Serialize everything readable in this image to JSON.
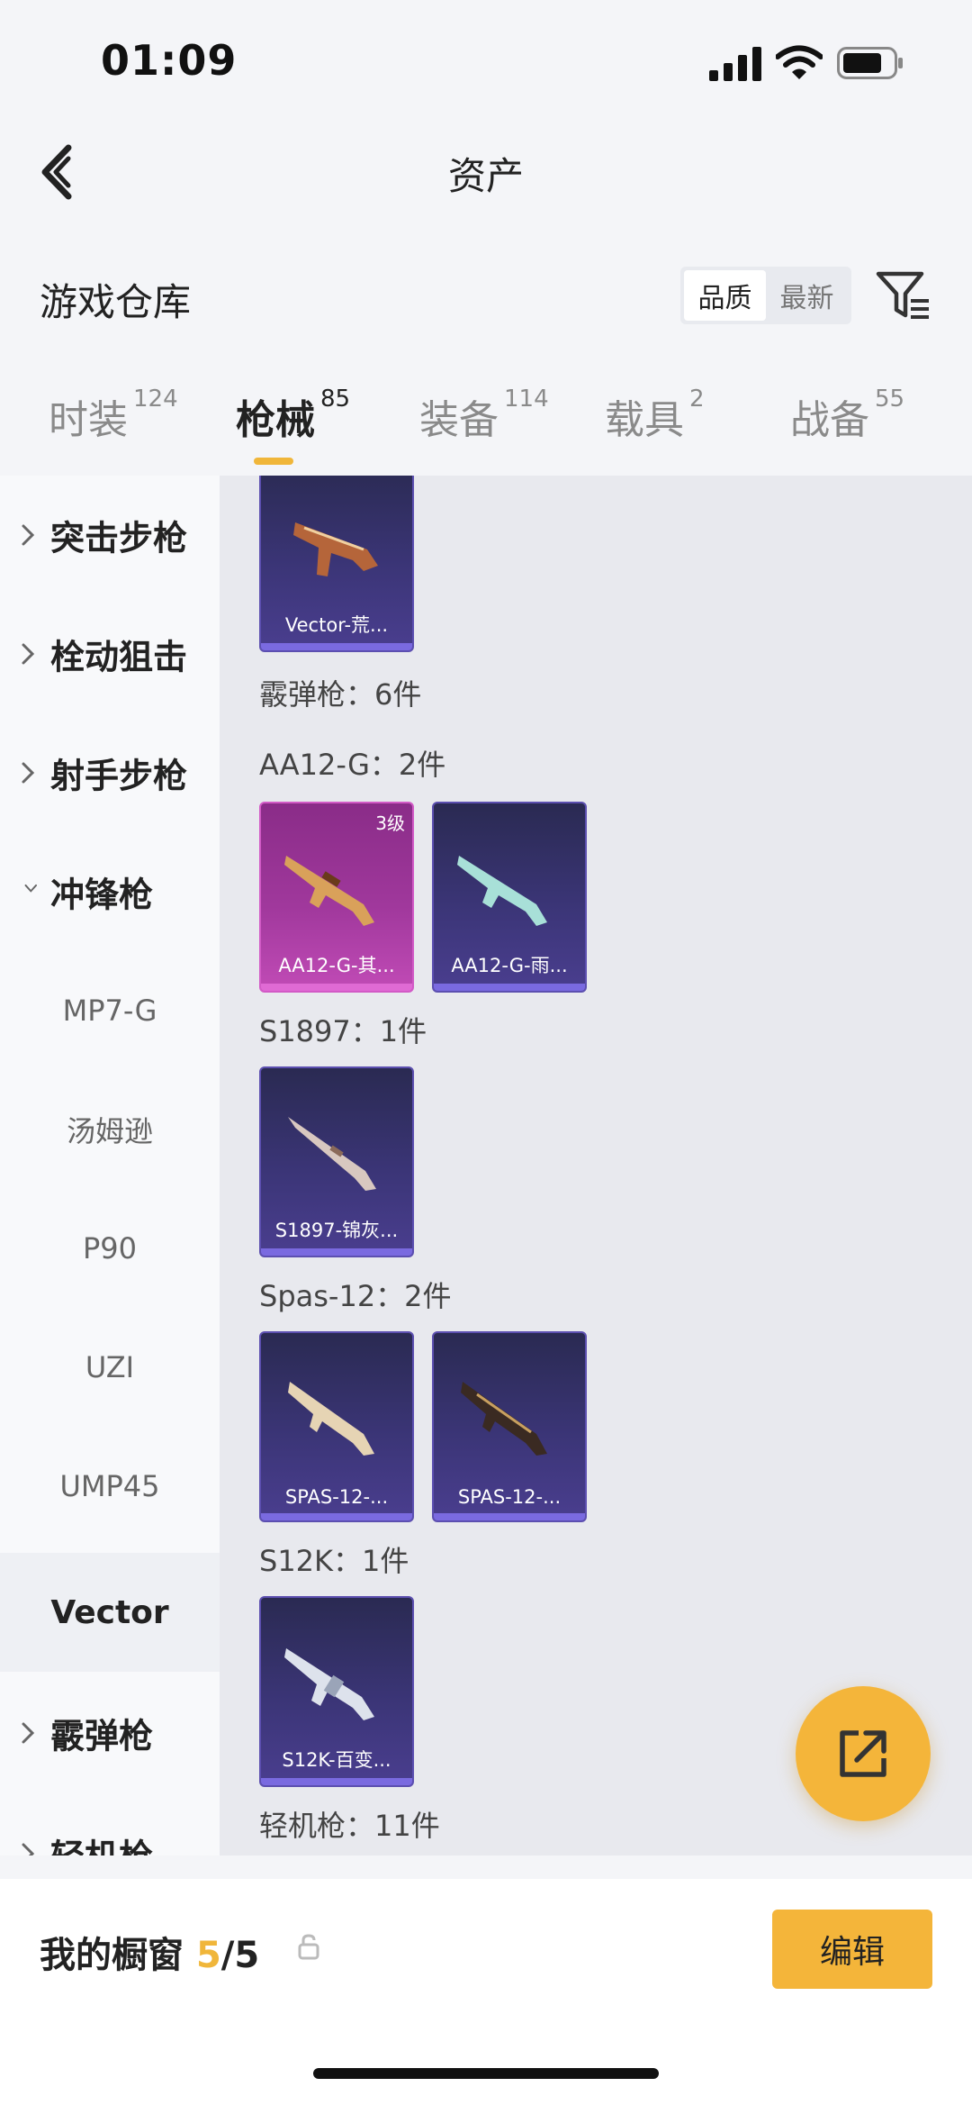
{
  "status_bar": {
    "time": "01:09"
  },
  "nav": {
    "title": "资产"
  },
  "warehouse": {
    "title": "游戏仓库",
    "sort_options": [
      "品质",
      "最新"
    ],
    "active_sort": "品质"
  },
  "tabs": [
    {
      "label": "时装",
      "count": "124"
    },
    {
      "label": "枪械",
      "count": "85"
    },
    {
      "label": "装备",
      "count": "114"
    },
    {
      "label": "载具",
      "count": "2"
    },
    {
      "label": "战备",
      "count": "55"
    }
  ],
  "active_tab": "枪械",
  "sidebar": {
    "categories": [
      {
        "label": "突击步枪",
        "expanded": false
      },
      {
        "label": "栓动狙击",
        "expanded": false
      },
      {
        "label": "射手步枪",
        "expanded": false
      },
      {
        "label": "冲锋枪",
        "expanded": true
      }
    ],
    "subcategories": [
      "MP7-G",
      "汤姆逊",
      "P90",
      "UZI",
      "UMP45",
      "Vector"
    ],
    "active_sub": "Vector",
    "more_categories": [
      {
        "label": "霰弹枪",
        "expanded": false
      },
      {
        "label": "轻机枪",
        "expanded": false
      }
    ]
  },
  "content": {
    "top_card": {
      "name": "Vector-荒...",
      "quality": "purple"
    },
    "section_title": "霰弹枪：6件",
    "groups": [
      {
        "title": "AA12-G：2件",
        "items": [
          {
            "name": "AA12-G-其...",
            "quality": "pink",
            "level": "3级"
          },
          {
            "name": "AA12-G-雨...",
            "quality": "purple"
          }
        ]
      },
      {
        "title": "S1897：1件",
        "items": [
          {
            "name": "S1897-锦灰...",
            "quality": "purple"
          }
        ]
      },
      {
        "title": "Spas-12：2件",
        "items": [
          {
            "name": "SPAS-12-...",
            "quality": "purple"
          },
          {
            "name": "SPAS-12-...",
            "quality": "purple"
          }
        ]
      },
      {
        "title": "S12K：1件",
        "items": [
          {
            "name": "S12K-百变...",
            "quality": "purple"
          }
        ]
      }
    ],
    "next_section_title": "轻机枪：11件"
  },
  "bottom": {
    "showcase_label": "我的橱窗",
    "showcase_used": "5",
    "showcase_total": "/5",
    "edit_label": "编辑"
  },
  "colors": {
    "accent": "#f4b53a",
    "purple_card": "#3b3577",
    "pink_card": "#a0389c"
  },
  "icons": [
    "back-arrow-icon",
    "filter-icon",
    "chevron-right-icon",
    "chevron-down-icon",
    "share-icon",
    "lock-icon",
    "signal-icon",
    "wifi-icon",
    "battery-icon"
  ]
}
